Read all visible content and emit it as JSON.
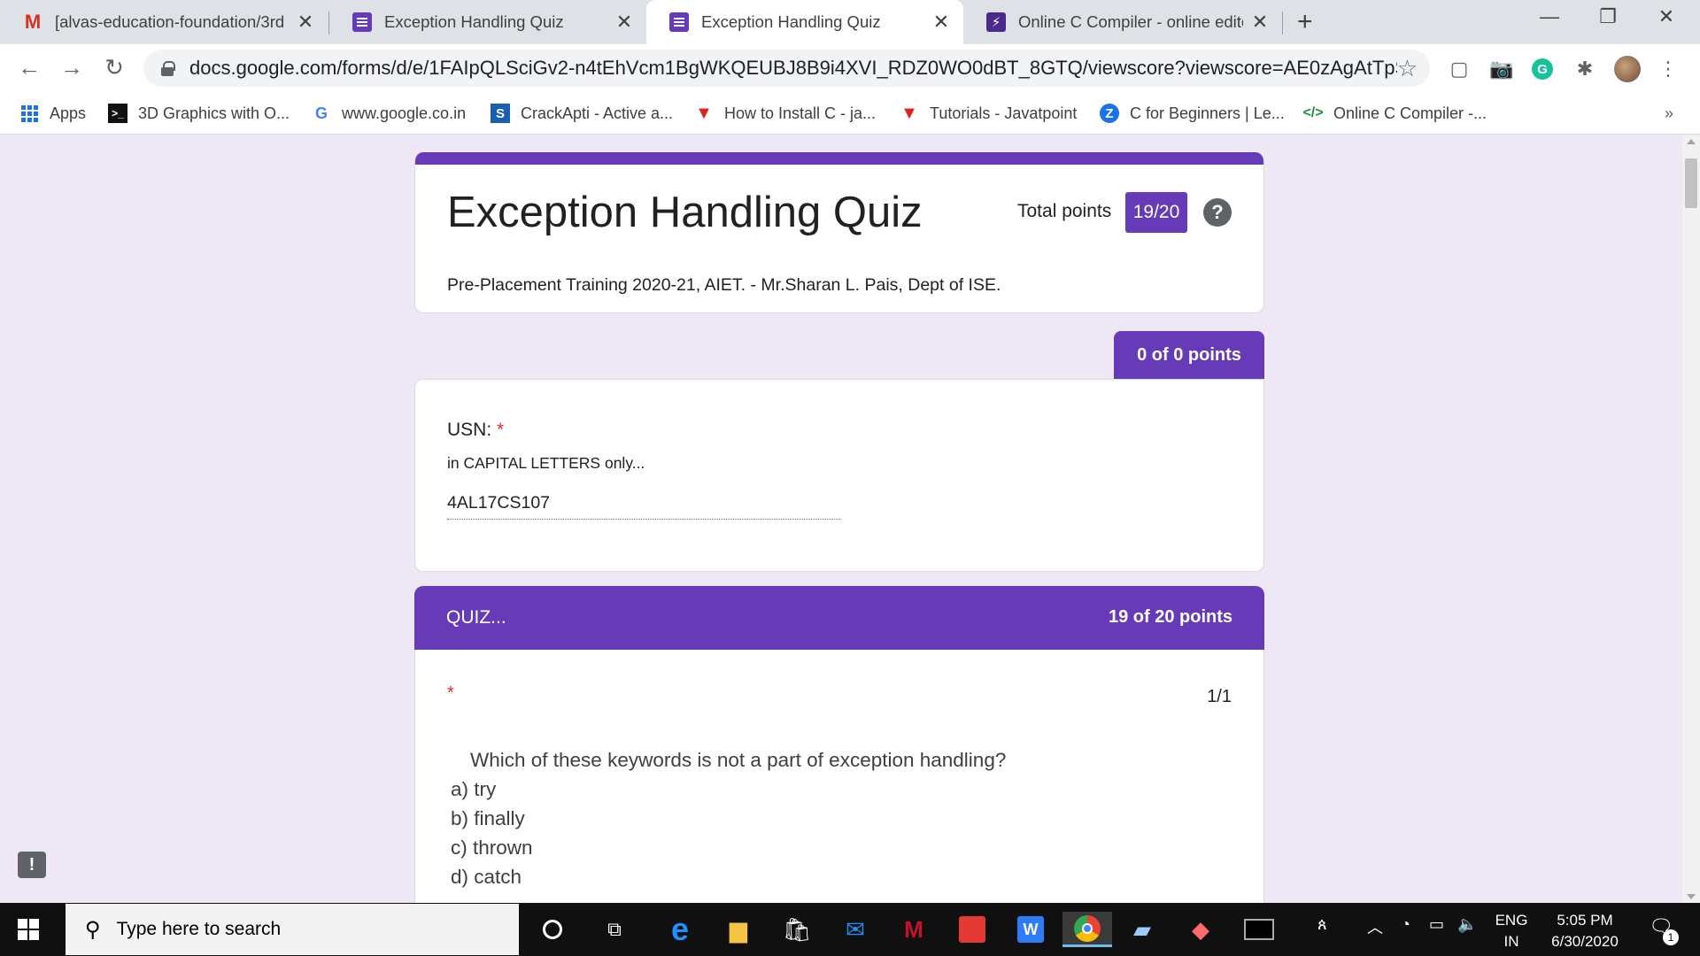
{
  "browser": {
    "tabs": [
      {
        "title": "[alvas-education-foundation/3rd",
        "icon": "gmail-icon"
      },
      {
        "title": "Exception Handling Quiz",
        "icon": "google-forms-icon"
      },
      {
        "title": "Exception Handling Quiz",
        "icon": "google-forms-icon",
        "active": true
      },
      {
        "title": "Online C Compiler - online editor",
        "icon": "compiler-icon"
      }
    ],
    "url": "docs.google.com/forms/d/e/1FAIpQLSciGv2-n4tEhVcm1BgWKQEUBJ8B9i4XVI_RDZ0WO0dBT_8GTQ/viewscore?viewscore=AE0zAgAtTpSKy5Gp...",
    "bookmarks": [
      {
        "label": "Apps"
      },
      {
        "label": "3D Graphics with O..."
      },
      {
        "label": "www.google.co.in"
      },
      {
        "label": "CrackApti - Active a..."
      },
      {
        "label": "How to Install C - ja..."
      },
      {
        "label": "Tutorials - Javatpoint"
      },
      {
        "label": "C for Beginners | Le..."
      },
      {
        "label": "Online C Compiler -..."
      }
    ],
    "more": "»"
  },
  "form": {
    "title": "Exception Handling Quiz",
    "total_points_label": "Total points",
    "total_points_value": "19/20",
    "description": "Pre-Placement Training 2020-21, AIET.  - Mr.Sharan L. Pais, Dept of ISE.",
    "section1_points": "0 of 0 points",
    "usn": {
      "label": "USN:",
      "required_mark": "*",
      "help": "in CAPITAL LETTERS only...",
      "answer": "4AL17CS107"
    },
    "quiz_section": {
      "title": "QUIZ...",
      "points": "19 of 20 points"
    },
    "question1": {
      "required_mark": "*",
      "score": "1/1",
      "text": "Which of these keywords is not a part of exception handling?",
      "options": [
        "a) try",
        "b) finally",
        "c) thrown",
        "d) catch"
      ]
    }
  },
  "taskbar": {
    "search_placeholder": "Type here to search",
    "lang_top": "ENG",
    "lang_bottom": "IN",
    "time": "5:05 PM",
    "date": "6/30/2020",
    "notification_count": "1"
  },
  "colors": {
    "accent": "#673ab7",
    "background": "#ede7f6",
    "required": "#d93025"
  }
}
